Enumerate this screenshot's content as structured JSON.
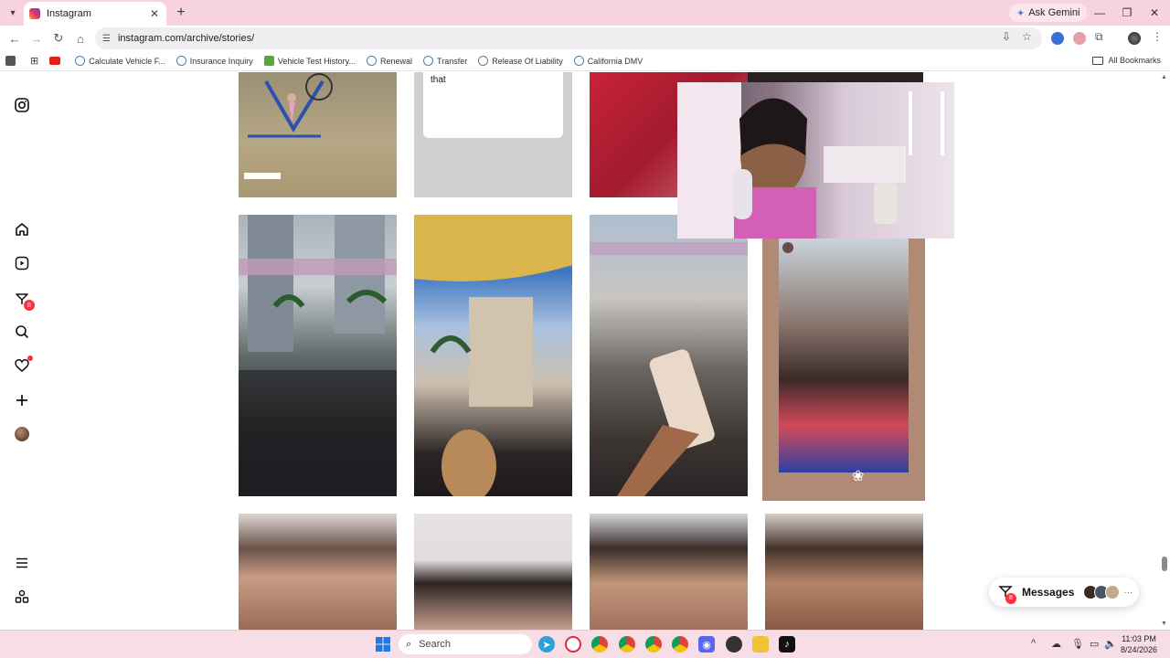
{
  "browser": {
    "tab_title": "Instagram",
    "ask_gemini": "Ask Gemini",
    "url": "instagram.com/archive/stories/",
    "bookmarks": [
      {
        "label": "Calculate  Vehicle F..."
      },
      {
        "label": "Insurance Inquiry"
      },
      {
        "label": "Vehicle Test History..."
      },
      {
        "label": "Renewal"
      },
      {
        "label": "Transfer"
      },
      {
        "label": "Release Of Liability"
      },
      {
        "label": "California DMV"
      }
    ],
    "all_bookmarks": "All Bookmarks"
  },
  "sidebar": {
    "messages_badge": "8"
  },
  "stories": {
    "top_row_caption": "that"
  },
  "messages": {
    "label": "Messages",
    "badge": "8"
  },
  "taskbar": {
    "search_placeholder": "Search",
    "time": "11:03 PM",
    "date": "8/24/2026"
  },
  "colors": {
    "tabbar_bg": "#f6d3df",
    "taskbar_bg": "#f7dde6",
    "badge_red": "#ff3040"
  }
}
